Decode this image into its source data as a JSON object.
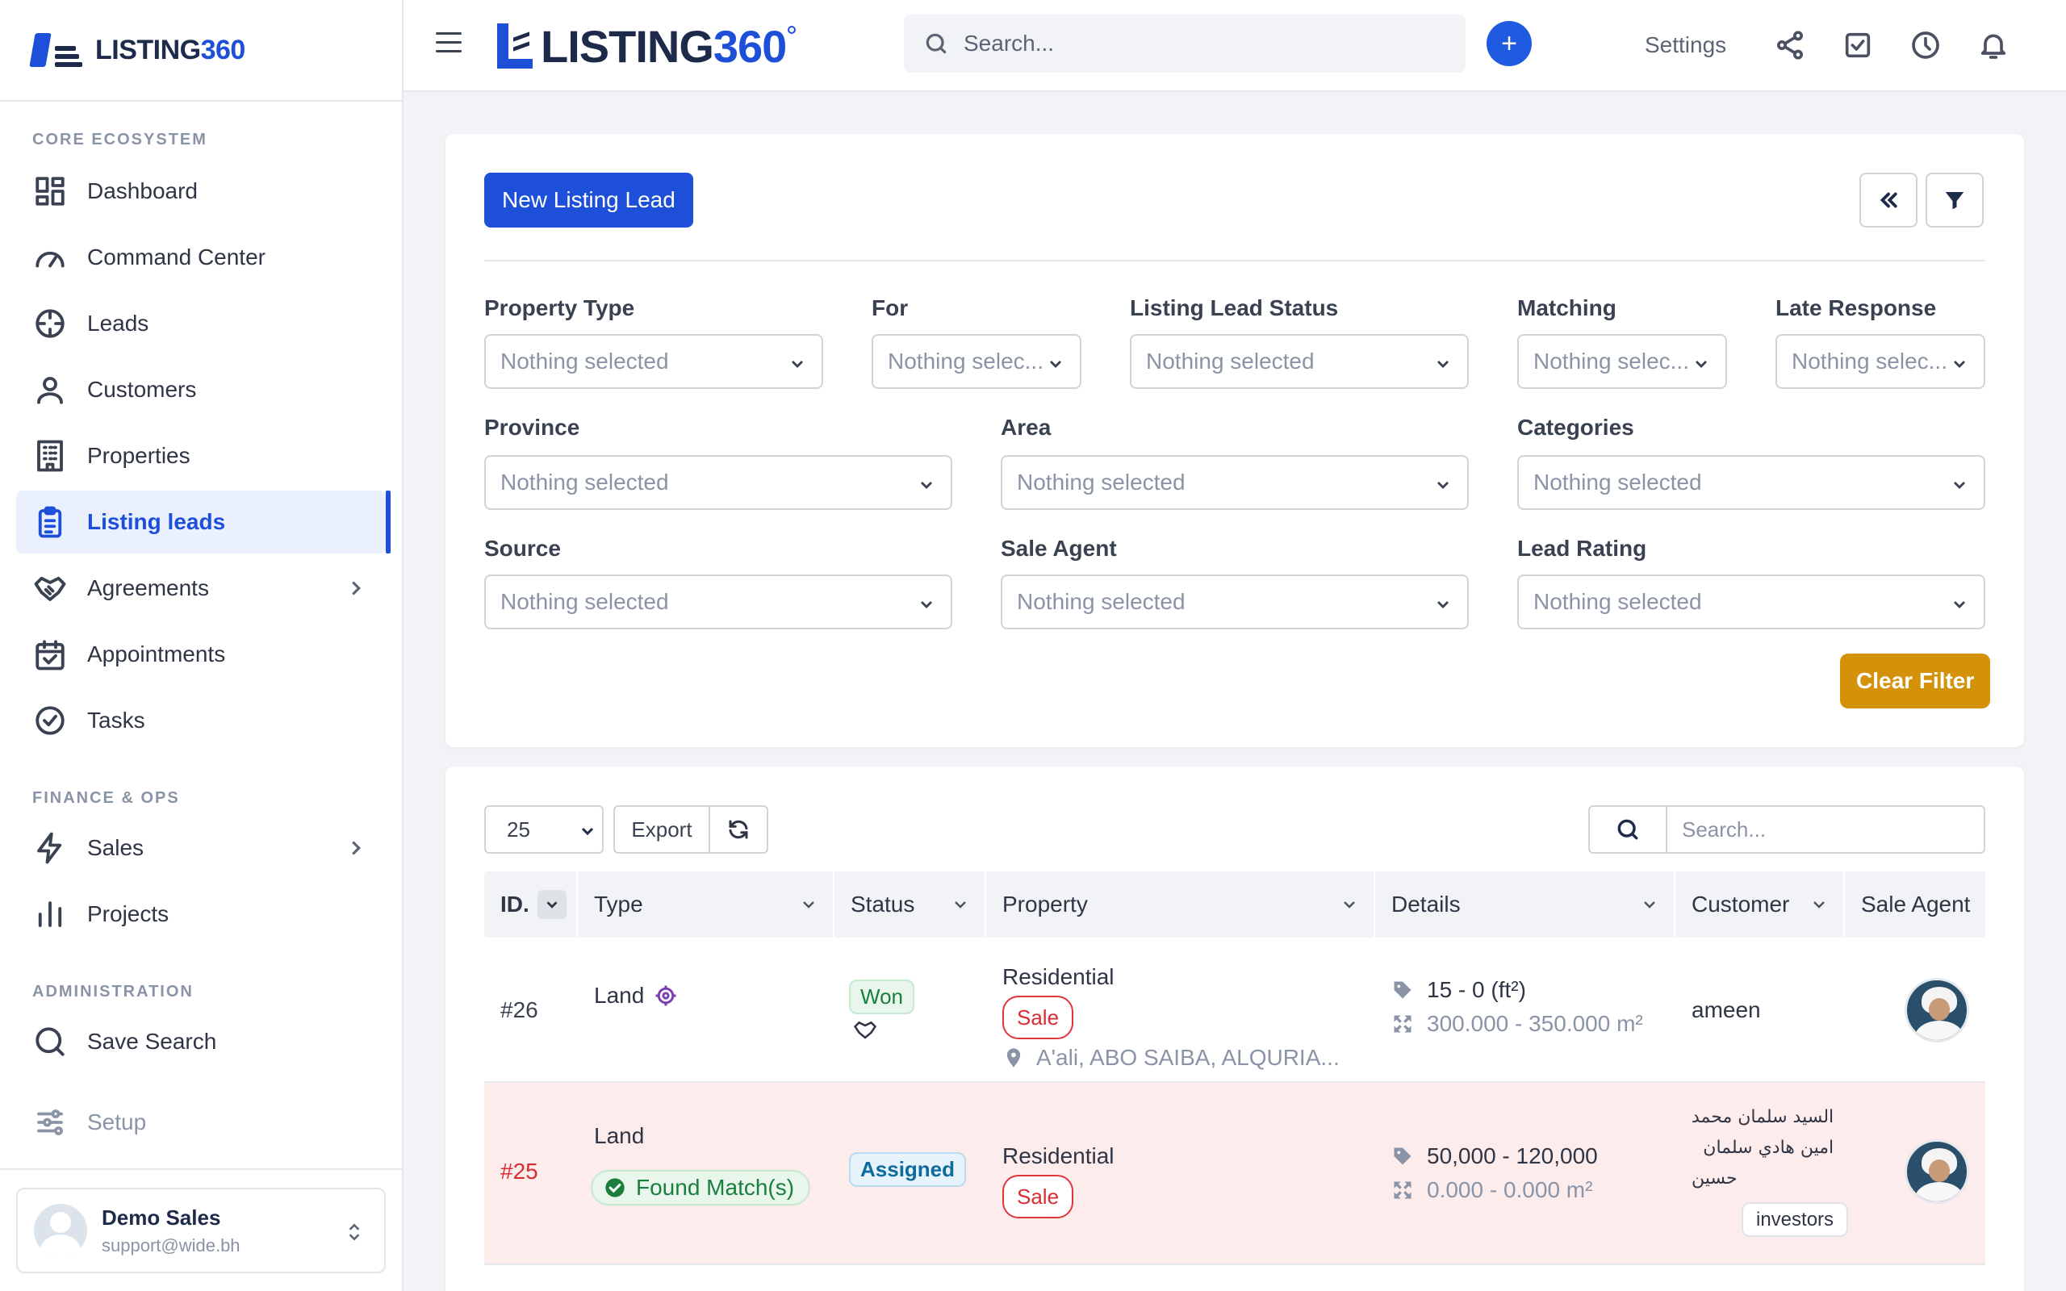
{
  "brand": {
    "name_a": "LISTING",
    "name_b": "360"
  },
  "sidebar": {
    "sections": [
      "CORE ECOSYSTEM",
      "FINANCE & OPS",
      "ADMINISTRATION"
    ],
    "items": [
      {
        "label": "Dashboard",
        "icon": "dashboard-icon"
      },
      {
        "label": "Command Center",
        "icon": "gauge-icon"
      },
      {
        "label": "Leads",
        "icon": "crosshair-icon"
      },
      {
        "label": "Customers",
        "icon": "user-icon"
      },
      {
        "label": "Properties",
        "icon": "building-icon"
      },
      {
        "label": "Listing leads",
        "icon": "clipboard-list-icon",
        "active": true
      },
      {
        "label": "Agreements",
        "icon": "handshake-icon",
        "has_children": true
      },
      {
        "label": "Appointments",
        "icon": "calendar-icon"
      },
      {
        "label": "Tasks",
        "icon": "check-circle-icon"
      },
      {
        "label": "Sales",
        "icon": "lightning-icon",
        "has_children": true
      },
      {
        "label": "Projects",
        "icon": "bar-chart-icon"
      },
      {
        "label": "Save Search",
        "icon": "search-icon"
      },
      {
        "label": "Setup",
        "icon": "sliders-icon"
      }
    ],
    "user": {
      "name": "Demo Sales",
      "email": "support@wide.bh"
    }
  },
  "topbar": {
    "search_placeholder": "Search...",
    "settings_label": "Settings",
    "icons": [
      "share-icon",
      "checkbox-icon",
      "clock-icon",
      "bell-icon"
    ]
  },
  "filters": {
    "new_button": "New Listing Lead",
    "clear_button": "Clear Filter",
    "placeholder": "Nothing selected",
    "placeholder_short": "Nothing selec...",
    "labels": {
      "property_type": "Property Type",
      "for": "For",
      "listing_lead_status": "Listing Lead Status",
      "matching": "Matching",
      "late_response": "Late Response",
      "province": "Province",
      "area": "Area",
      "categories": "Categories",
      "source": "Source",
      "sale_agent": "Sale Agent",
      "lead_rating": "Lead Rating"
    }
  },
  "table": {
    "page_size": "25",
    "export_label": "Export",
    "search_placeholder": "Search...",
    "columns": [
      "ID.",
      "Type",
      "Status",
      "Property",
      "Details",
      "Customer",
      "Sale Agent"
    ],
    "rows": [
      {
        "id": "#26",
        "type": "Land",
        "status": "Won",
        "property_category": "Residential",
        "property_for": "Sale",
        "location": "A'ali, ABO SAIBA, ALQURIA...",
        "price": "15 - 0 (ft²)",
        "area": "300.000 - 350.000 m²",
        "customer": "ameen"
      },
      {
        "id": "#25",
        "type": "Land",
        "match_label": "Found Match(s)",
        "status": "Assigned",
        "property_category": "Residential",
        "property_for": "Sale",
        "price": "50,000 - 120,000",
        "area": "0.000 - 0.000 m²",
        "customer_lines": [
          "السيد سلمان محمد",
          "امين هادي سلمان",
          "حسين"
        ],
        "customer_tag": "investors"
      }
    ]
  },
  "colors": {
    "primary": "#1e4fd8",
    "warning": "#d4920a",
    "danger": "#d92d32",
    "success": "#1a7f3c"
  }
}
